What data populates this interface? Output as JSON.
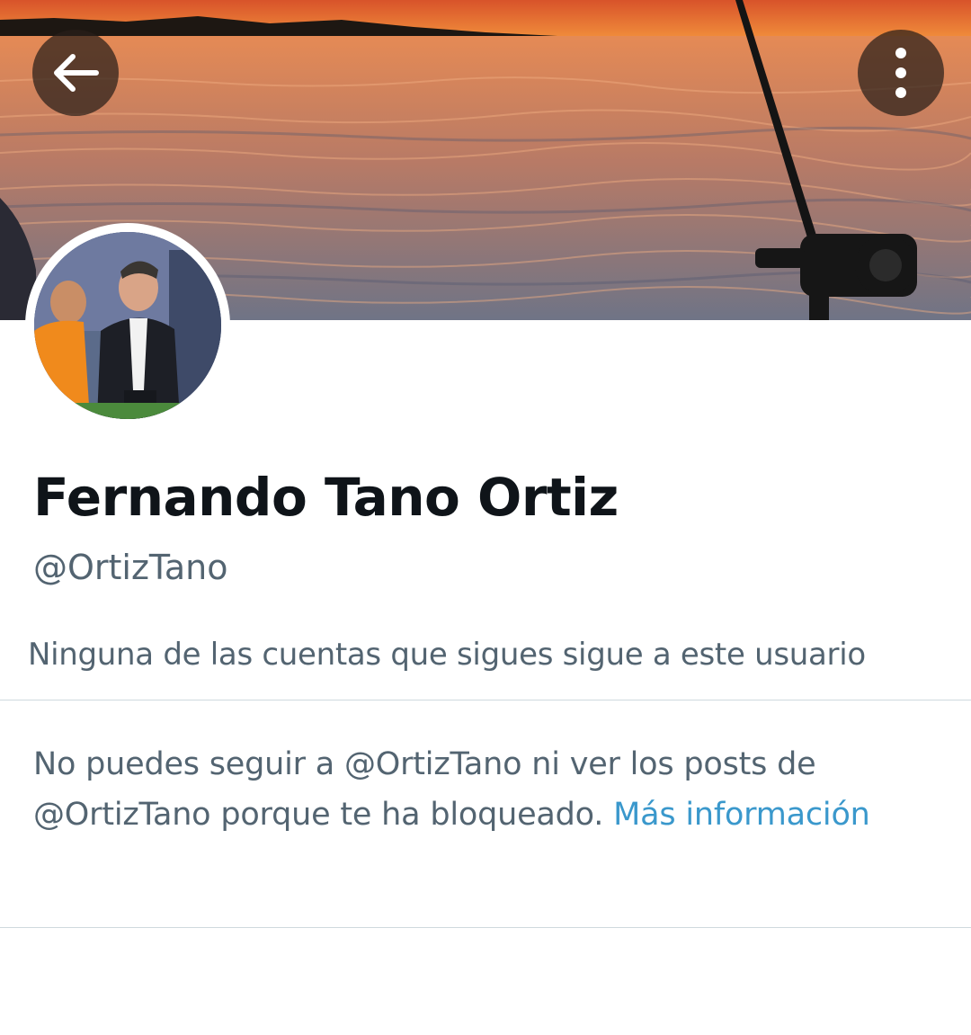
{
  "header": {
    "back_icon": "arrow-left-icon",
    "more_icon": "more-vertical-icon"
  },
  "profile": {
    "display_name": "Fernando Tano Ortiz",
    "handle": "@OrtizTano",
    "followers_note": "Ninguna de las cuentas que sigues sigue a este usuario"
  },
  "blocked_notice": {
    "text": "No puedes seguir a @OrtizTano ni ver los posts de @OrtizTano porque te ha bloqueado. ",
    "link_label": "Más información"
  },
  "colors": {
    "primary_text": "#0f1419",
    "secondary_text": "#536471",
    "link": "#1d9bf0",
    "divider": "#cfd9de"
  }
}
